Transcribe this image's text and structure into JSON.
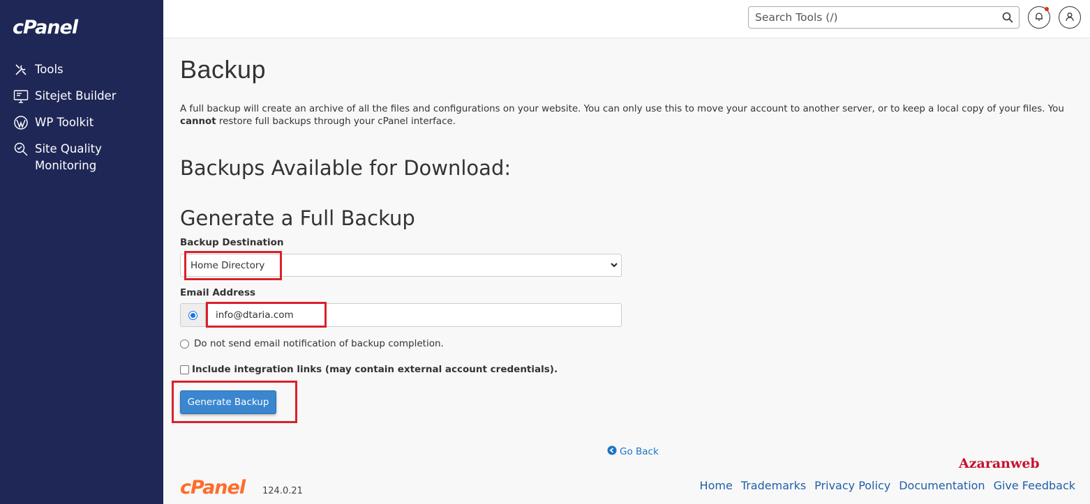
{
  "brand": {
    "logo_text": "cPanel"
  },
  "sidebar": {
    "items": [
      {
        "label": "Tools",
        "icon": "tools-icon"
      },
      {
        "label": "Sitejet Builder",
        "icon": "monitor-icon"
      },
      {
        "label": "WP Toolkit",
        "icon": "wordpress-icon"
      },
      {
        "label": "Site Quality Monitoring",
        "icon": "magnifier-icon"
      }
    ]
  },
  "header": {
    "search_placeholder": "Search Tools (/)"
  },
  "main": {
    "title": "Backup",
    "intro_text": "A full backup will create an archive of all the files and configurations on your website. You can only use this to move your account to another server, or to keep a local copy of your files. You ",
    "intro_bold": "cannot",
    "intro_after": " restore full backups through your cPanel interface.",
    "heading_available": "Backups Available for Download:",
    "heading_generate": "Generate a Full Backup",
    "destination_label": "Backup Destination",
    "destination_value": "Home Directory",
    "email_label": "Email Address",
    "email_value": "info@dtaria.com",
    "no_email_label": "Do not send email notification of backup completion.",
    "integration_label": "Include integration links (may contain external account credentials).",
    "generate_button": "Generate Backup",
    "go_back": "Go Back"
  },
  "footer": {
    "logo_text": "cPanel",
    "version": "124.0.21",
    "watermark": "Azaranweb",
    "links": [
      "Home",
      "Trademarks",
      "Privacy Policy",
      "Documentation",
      "Give Feedback"
    ]
  },
  "colors": {
    "sidebar_bg": "#1e2756",
    "accent": "#3a86cf",
    "highlight": "#d9212a",
    "footer_logo": "#ff6c2c"
  }
}
